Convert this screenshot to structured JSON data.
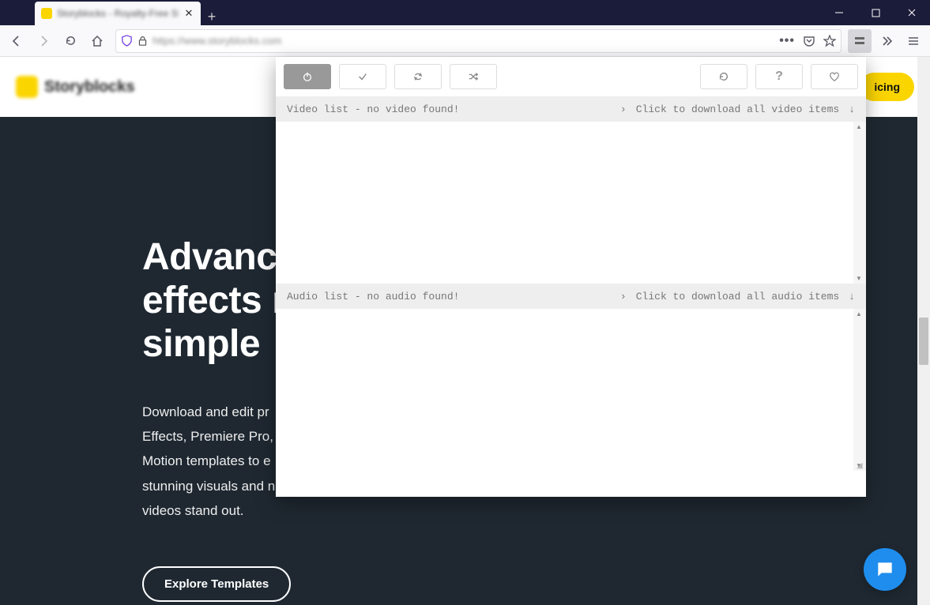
{
  "window": {
    "tab_title": "Storyblocks - Royalty-Free St…"
  },
  "urlbar": {
    "text": "https://www.storyblocks.com"
  },
  "site": {
    "brand": "Storyblocks",
    "pricing_label": "icing",
    "hero_title_l1": "Advanced",
    "hero_title_l2": "effects m",
    "hero_title_l3": "simple",
    "hero_body": "Download and edit pr\nEffects, Premiere Pro,\nMotion templates to e\nstunning visuals and n\nvideos stand out.",
    "explore_label": "Explore Templates"
  },
  "popup": {
    "video_header": "Video list - no video found!",
    "video_download": "Click to download all video items",
    "audio_header": "Audio list - no audio found!",
    "audio_download": "Click to download all audio items"
  }
}
